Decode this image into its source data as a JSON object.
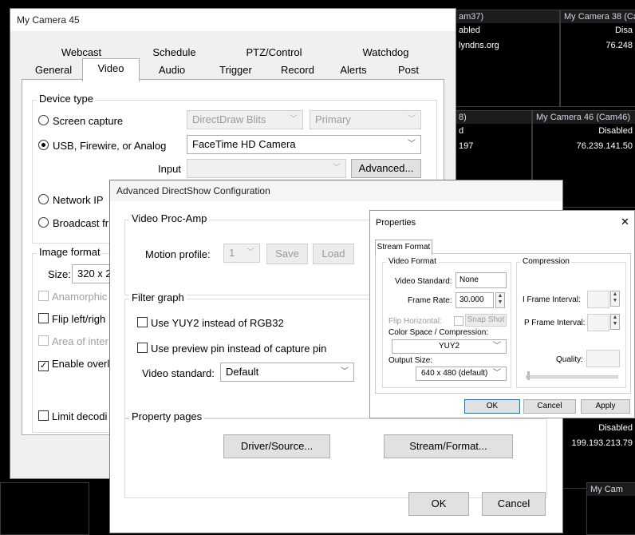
{
  "background_tiles": [
    {
      "title": "am37)",
      "lines": [
        "abled",
        "lyndns.org"
      ]
    },
    {
      "title": "My Camera 38 (Ca",
      "lines": [
        "Disa",
        "76.248"
      ]
    },
    {
      "title": "8)",
      "lines": [
        "d",
        "197"
      ]
    },
    {
      "title": "My Camera 46 (Cam46)",
      "lines": [
        "Disabled",
        "76.239.141.50"
      ]
    },
    {
      "title": "",
      "lines": [
        "Disabled",
        "199.193.213.79"
      ]
    },
    {
      "title": "My Cam",
      "lines": []
    }
  ],
  "camera_window": {
    "title": "My Camera 45",
    "tabs_row1": [
      "Webcast",
      "Schedule",
      "PTZ/Control",
      "Watchdog"
    ],
    "tabs_row2": [
      "General",
      "Video",
      "Audio",
      "Trigger",
      "Record",
      "Alerts",
      "Post"
    ],
    "device_type": {
      "label": "Device type",
      "screen_capture": "Screen capture",
      "screen_combo1": "DirectDraw Blits",
      "screen_combo2": "Primary",
      "usb": "USB, Firewire, or Analog",
      "usb_device": "FaceTime HD Camera",
      "input_label": "Input",
      "advanced_button": "Advanced...",
      "network_ip": "Network IP",
      "broadcast": "Broadcast fr"
    },
    "image_format": {
      "label": "Image format",
      "size_label": "Size:",
      "size_value": "320 x 2",
      "anamorphic": "Anamorphic",
      "flip": "Flip left/righ",
      "area": "Area of inter",
      "enable_overlay": "Enable overl",
      "limit": "Limit decodi"
    }
  },
  "adv_window": {
    "title": "Advanced DirectShow Configuration",
    "proc_amp": {
      "label": "Video Proc-Amp",
      "motion_label": "Motion profile:",
      "motion_value": "1",
      "save": "Save",
      "load": "Load"
    },
    "filter_graph": {
      "label": "Filter graph",
      "yuy2": "Use YUY2 instead of RGB32",
      "preview_pin": "Use preview pin instead of capture pin",
      "video_standard_label": "Video standard:",
      "video_standard_value": "Default"
    },
    "property_pages": {
      "label": "Property pages",
      "driver": "Driver/Source...",
      "stream": "Stream/Format..."
    },
    "ok": "OK",
    "cancel": "Cancel"
  },
  "props_window": {
    "title": "Properties",
    "close": "✕",
    "tab": "Stream Format",
    "video_format": {
      "label": "Video Format",
      "standard_label": "Video Standard:",
      "standard_value": "None",
      "frame_rate_label": "Frame Rate:",
      "frame_rate_value": "30.000",
      "flip_label": "Flip Horizontal:",
      "snap_shot": "Snap Shot",
      "color_space_label": "Color Space / Compression:",
      "color_space_value": "YUY2",
      "output_size_label": "Output Size:",
      "output_size_value": "640 x 480  (default)"
    },
    "compression": {
      "label": "Compression",
      "i_frame": "I Frame Interval:",
      "p_frame": "P Frame Interval:",
      "quality": "Quality:"
    },
    "ok": "OK",
    "cancel": "Cancel",
    "apply": "Apply"
  }
}
